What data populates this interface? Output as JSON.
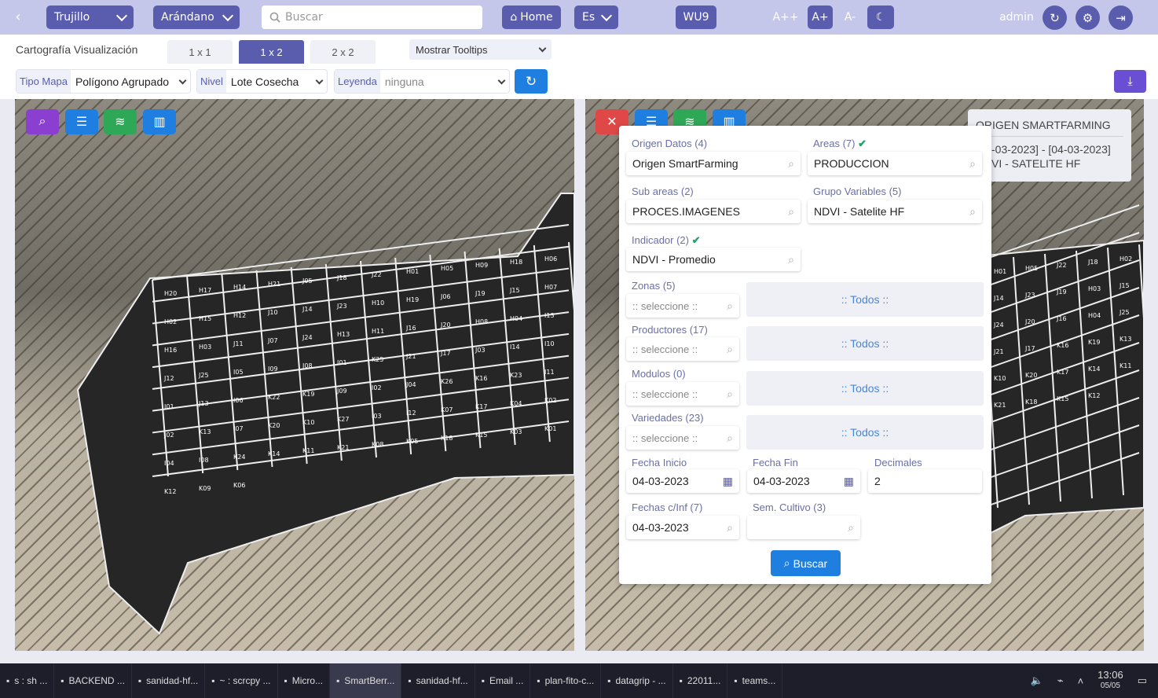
{
  "topbar": {
    "city": "Trujillo",
    "crop": "Arándano",
    "search_placeholder": "Buscar",
    "home": "Home",
    "lang": "Es",
    "wu": "WU9",
    "font_plus2": "A++",
    "font_plus": "A+",
    "font_minus": "A-",
    "user": "admin"
  },
  "toolbar": {
    "title": "Cartografía Visualización",
    "tabs": [
      "1 x 1",
      "1 x 2",
      "2 x 2"
    ],
    "tooltips": "Mostrar Tooltips",
    "tipo_mapa_label": "Tipo Mapa",
    "tipo_mapa_value": "Polígono Agrupado",
    "nivel_label": "Nivel",
    "nivel_value": "Lote Cosecha",
    "leyenda_label": "Leyenda",
    "leyenda_value": "ninguna"
  },
  "infobox": {
    "title": "ORIGEN SMARTFARMING",
    "line1": "-03-2023] - [04-03-2023]",
    "line2": "VI - SATELITE HF"
  },
  "panel": {
    "origen_label": "Origen Datos (4)",
    "origen_value": "Origen SmartFarming",
    "areas_label": "Areas (7)",
    "areas_value": "PRODUCCION",
    "subareas_label": "Sub areas (2)",
    "subareas_value": "PROCES.IMAGENES",
    "grupo_label": "Grupo Variables (5)",
    "grupo_value": "NDVI - Satelite HF",
    "indicador_label": "Indicador (2)",
    "indicador_value": "NDVI - Promedio",
    "zonas_label": "Zonas (5)",
    "productores_label": "Productores (17)",
    "modulos_label": "Modulos (0)",
    "variedades_label": "Variedades (23)",
    "seleccione": ":: seleccione ::",
    "todos": ":: Todos ::",
    "fecha_inicio_label": "Fecha Inicio",
    "fecha_inicio": "04-03-2023",
    "fecha_fin_label": "Fecha Fin",
    "fecha_fin": "04-03-2023",
    "decimales_label": "Decimales",
    "decimales": "2",
    "fechas_inf_label": "Fechas c/Inf (7)",
    "fechas_inf": "04-03-2023",
    "sem_cultivo_label": "Sem. Cultivo (3)",
    "buscar": "Buscar"
  },
  "map_left_labels": [
    "H20",
    "H17",
    "H14",
    "H21",
    "J05",
    "J18",
    "J22",
    "H01",
    "H05",
    "H09",
    "H18",
    "H06",
    "H02",
    "H15",
    "H12",
    "J10",
    "J14",
    "J23",
    "H10",
    "H19",
    "J06",
    "J19",
    "J15",
    "H07",
    "H16",
    "H03",
    "J11",
    "J07",
    "J24",
    "H13",
    "H11",
    "J16",
    "J20",
    "H08",
    "H04",
    "I13",
    "J12",
    "J25",
    "I05",
    "I09",
    "J08",
    "I01",
    "K25",
    "J21",
    "J17",
    "J03",
    "I14",
    "I10",
    "J01",
    "J13",
    "I06",
    "K22",
    "K19",
    "J09",
    "I02",
    "J04",
    "K26",
    "K16",
    "K23",
    "I11",
    "J02",
    "K13",
    "I07",
    "K20",
    "K10",
    "K27",
    "I03",
    "I12",
    "K07",
    "K17",
    "K04",
    "K02",
    "I04",
    "I08",
    "K24",
    "K14",
    "K11",
    "K21",
    "K08",
    "K05",
    "K18",
    "K15",
    "K03",
    "K01",
    "K12",
    "K09",
    "K06"
  ],
  "map_right_labels": [
    "H01",
    "H05",
    "J22",
    "J18",
    "H02",
    "J14",
    "J23",
    "J19",
    "H03",
    "J15",
    "J24",
    "J20",
    "J16",
    "H04",
    "J25",
    "J21",
    "J17",
    "K16",
    "K19",
    "K13",
    "K10",
    "K20",
    "K17",
    "K14",
    "K11",
    "K21",
    "K18",
    "K15",
    "K12"
  ],
  "taskbar": {
    "items": [
      "s : sh ...",
      "BACKEND ...",
      "sanidad-hf...",
      "~ : scrcpy ...",
      "Micro...",
      "SmartBerr...",
      "sanidad-hf...",
      "Email ...",
      "plan-fito-c...",
      "datagrip - ...",
      "22011...",
      "teams..."
    ],
    "time": "13:06",
    "date": "05/05"
  }
}
